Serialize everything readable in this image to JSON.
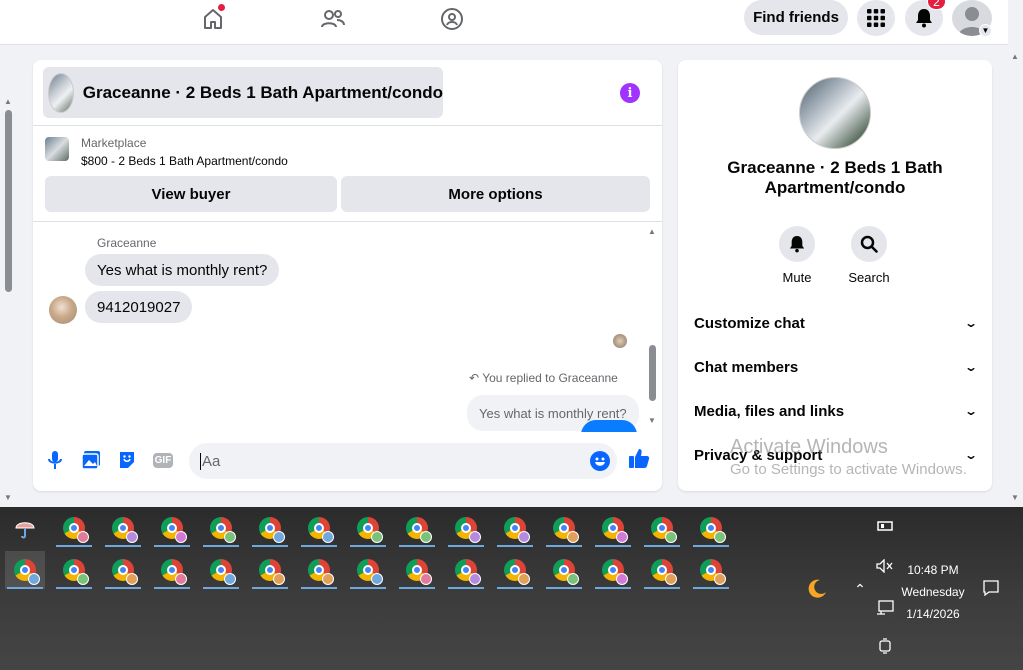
{
  "topnav": {
    "find_friends_label": "Find friends",
    "notification_count": "2"
  },
  "chat": {
    "header_title": "Graceanne · 2 Beds 1 Bath Apartment/condo",
    "marketplace_label": "Marketplace",
    "listing_line": "$800 - 2 Beds 1 Bath Apartment/condo",
    "view_buyer_label": "View buyer",
    "more_options_label": "More options",
    "sender_name": "Graceanne",
    "messages_in": [
      "Yes what is monthly rent?",
      "9412019027"
    ],
    "replied_label": "You replied to Graceanne",
    "quoted_message": "Yes what is monthly rent?",
    "composer_placeholder": "Aa",
    "gif_label": "GIF"
  },
  "info_panel": {
    "title": "Graceanne · 2 Beds 1 Bath Apartment/condo",
    "actions": [
      {
        "label": "Mute",
        "icon": "bell-icon"
      },
      {
        "label": "Search",
        "icon": "search-icon"
      }
    ],
    "sections": [
      "Customize chat",
      "Chat members",
      "Media, files and links",
      "Privacy & support"
    ]
  },
  "watermark": {
    "line1": "Activate Windows",
    "line2": "Go to Settings to activate Windows."
  },
  "taskbar": {
    "time": "10:48 PM",
    "day": "Wednesday",
    "date": "1/14/2026",
    "row1_profile_colors": [
      "#e07b9b",
      "#b58be0",
      "#d17bd6",
      "#7ac27a",
      "#6fa8dc",
      "#6fa8dc",
      "#7ac27a",
      "#7ac27a",
      "#b58be0",
      "#b58be0",
      "#e0a05a",
      "#d17bd6",
      "#7ac27a",
      "#7ac27a"
    ],
    "row2_profile_colors": [
      "#6fa8dc",
      "#7ac27a",
      "#e0a05a",
      "#e07b9b",
      "#6fa8dc",
      "#e0a05a",
      "#e0a05a",
      "#6fa8dc",
      "#e07b9b",
      "#b58be0",
      "#e0a05a",
      "#7ac27a",
      "#d17bd6",
      "#e0a05a",
      "#e0a05a"
    ]
  },
  "colors": {
    "messenger_blue": "#0866ff",
    "info_purple": "#a033ff",
    "notification_red": "#e41e3f"
  }
}
